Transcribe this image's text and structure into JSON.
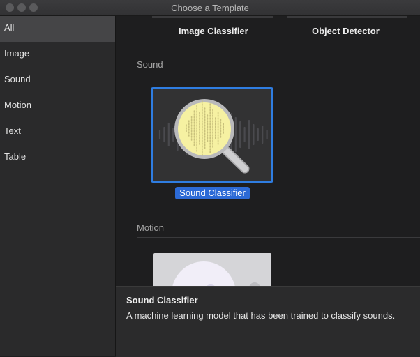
{
  "window": {
    "title": "Choose a Template"
  },
  "sidebar": {
    "items": [
      {
        "label": "All",
        "selected": true
      },
      {
        "label": "Image"
      },
      {
        "label": "Sound"
      },
      {
        "label": "Motion"
      },
      {
        "label": "Text"
      },
      {
        "label": "Table"
      }
    ]
  },
  "main": {
    "top_templates": [
      "Image Classifier",
      "Object Detector"
    ],
    "sections": [
      {
        "header": "Sound",
        "templates": [
          {
            "label": "Sound Classifier",
            "icon": "magnifier-waveform-icon",
            "selected": true
          }
        ]
      },
      {
        "header": "Motion",
        "templates": [
          {
            "label": "",
            "icon": "motion-disc-icon"
          }
        ]
      }
    ]
  },
  "info": {
    "title": "Sound Classifier",
    "description": "A machine learning model that has been trained to classify sounds."
  },
  "colors": {
    "accent": "#2f7de1",
    "selection": "#2c6ad6",
    "lens": "#f6f1a2"
  }
}
